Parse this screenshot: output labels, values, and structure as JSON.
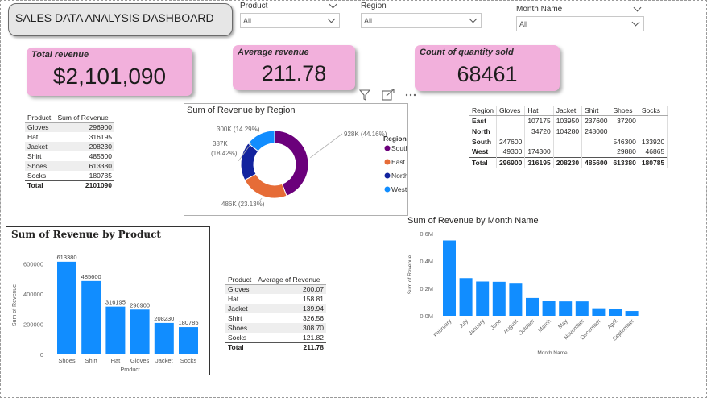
{
  "dashboard_title": "SALES DATA ANALYSIS DASHBOARD",
  "slicers": [
    {
      "label": "Product",
      "value": "All"
    },
    {
      "label": "Region",
      "value": "All"
    },
    {
      "label": "Month Name",
      "value": "All"
    }
  ],
  "kpis": [
    {
      "label": "Total revenue",
      "value": "$2,101,090"
    },
    {
      "label": "Average revenue",
      "value": "211.78"
    },
    {
      "label": "Count of quantity sold",
      "value": "68461"
    }
  ],
  "colors": {
    "kpi_bg": "#f2b0dc",
    "bar": "#118dff",
    "donut": [
      "#6b007b",
      "#e66c37",
      "#12239e",
      "#118dff"
    ]
  },
  "product_revenue_table": {
    "headers": [
      "Product",
      "Sum of Revenue"
    ],
    "rows": [
      [
        "Gloves",
        "296900"
      ],
      [
        "Hat",
        "316195"
      ],
      [
        "Jacket",
        "208230"
      ],
      [
        "Shirt",
        "485600"
      ],
      [
        "Shoes",
        "613380"
      ],
      [
        "Socks",
        "180785"
      ]
    ],
    "total": [
      "Total",
      "2101090"
    ]
  },
  "product_avg_table": {
    "headers": [
      "Product",
      "Average of Revenue"
    ],
    "rows": [
      [
        "Gloves",
        "200.07"
      ],
      [
        "Hat",
        "158.81"
      ],
      [
        "Jacket",
        "139.94"
      ],
      [
        "Shirt",
        "326.56"
      ],
      [
        "Shoes",
        "308.70"
      ],
      [
        "Socks",
        "121.82"
      ]
    ],
    "total": [
      "Total",
      "211.78"
    ]
  },
  "region_matrix": {
    "headers": [
      "Region",
      "Gloves",
      "Hat",
      "Jacket",
      "Shirt",
      "Shoes",
      "Socks"
    ],
    "rows": [
      [
        "East",
        "",
        "107175",
        "103950",
        "237600",
        "37200",
        ""
      ],
      [
        "North",
        "",
        "34720",
        "104280",
        "248000",
        "",
        ""
      ],
      [
        "South",
        "247600",
        "",
        "",
        "",
        "546300",
        "133920"
      ],
      [
        "West",
        "49300",
        "174300",
        "",
        "",
        "29880",
        "46865"
      ]
    ],
    "total": [
      "Total",
      "296900",
      "316195",
      "208230",
      "485600",
      "613380",
      "180785"
    ]
  },
  "visual_header_icons": [
    "filter-icon",
    "focus-mode-icon",
    "more-options-icon"
  ],
  "chart_data": [
    {
      "type": "pie",
      "title": "Sum of Revenue by Region",
      "legend_title": "Region",
      "legend_position": "right",
      "categories": [
        "South",
        "East",
        "North",
        "West"
      ],
      "values": [
        928000,
        486000,
        387000,
        300000
      ],
      "data_labels": [
        "928K (44.16%)",
        "486K (23.13%)",
        "387K (18.42%)",
        "300K (14.29%)"
      ]
    },
    {
      "type": "bar",
      "title": "Sum of Revenue by Product",
      "xlabel": "Product",
      "ylabel": "Sum of Revenue",
      "categories": [
        "Shoes",
        "Shirt",
        "Hat",
        "Gloves",
        "Jacket",
        "Socks"
      ],
      "values": [
        613380,
        485600,
        316195,
        296900,
        208230,
        180785
      ],
      "ylim": [
        0,
        650000
      ],
      "yticks": [
        0,
        200000,
        400000,
        600000
      ],
      "ytick_labels": [
        "0",
        "200000",
        "400000",
        "600000"
      ]
    },
    {
      "type": "bar",
      "title": "Sum of Revenue by Month Name",
      "xlabel": "Month Name",
      "ylabel": "Sum of Revenue",
      "categories": [
        "February",
        "July",
        "January",
        "June",
        "August",
        "October",
        "March",
        "May",
        "November",
        "December",
        "April",
        "September"
      ],
      "values": [
        550000,
        275000,
        250000,
        248000,
        240000,
        130000,
        110000,
        105000,
        105000,
        55000,
        50000,
        35000
      ],
      "ylim": [
        0,
        600000
      ],
      "yticks": [
        0,
        200000,
        400000,
        600000
      ],
      "ytick_labels": [
        "0.0M",
        "0.2M",
        "0.4M",
        "0.6M"
      ]
    }
  ]
}
